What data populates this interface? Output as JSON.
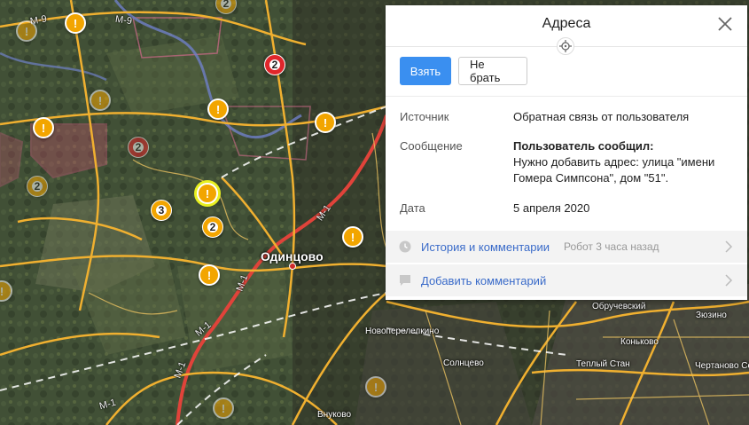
{
  "panel": {
    "title": "Адреса",
    "take_button": "Взять",
    "skip_button": "Не брать",
    "source_label": "Источник",
    "source_value": "Обратная связь от пользователя",
    "message_label": "Сообщение",
    "message_title": "Пользователь сообщил:",
    "message_text": "Нужно добавить адрес: улица \"имени Гомера Симпсона\", дом \"51\".",
    "date_label": "Дата",
    "date_value": "5 апреля 2020",
    "history_label": "История и комментарии",
    "history_meta": "Робот 3 часа назад",
    "add_comment_label": "Добавить комментарий"
  },
  "map": {
    "city_label": "Одинцово",
    "places": [
      "Новоперелелкино",
      "Солнцево",
      "Внуково",
      "Обручевский",
      "Коньково",
      "Теплый Стан",
      "Зюзино",
      "Чертаново Се"
    ],
    "road_labels": [
      "М-9",
      "М-9",
      "М-1",
      "М-1",
      "М-1",
      "М-1",
      "М-1"
    ],
    "markers": [
      {
        "kind": "cluster",
        "label": "2"
      },
      {
        "kind": "cluster",
        "label": "2"
      },
      {
        "kind": "cluster",
        "label": "2"
      },
      {
        "kind": "cluster",
        "label": "2"
      },
      {
        "kind": "cluster",
        "label": "3"
      },
      {
        "kind": "cluster",
        "label": "2"
      }
    ],
    "alert_glyph": "!"
  },
  "colors": {
    "accent": "#3a8ff0",
    "marker": "#f2a500",
    "marker_red": "#e0262b",
    "link": "#3a6bc9"
  }
}
